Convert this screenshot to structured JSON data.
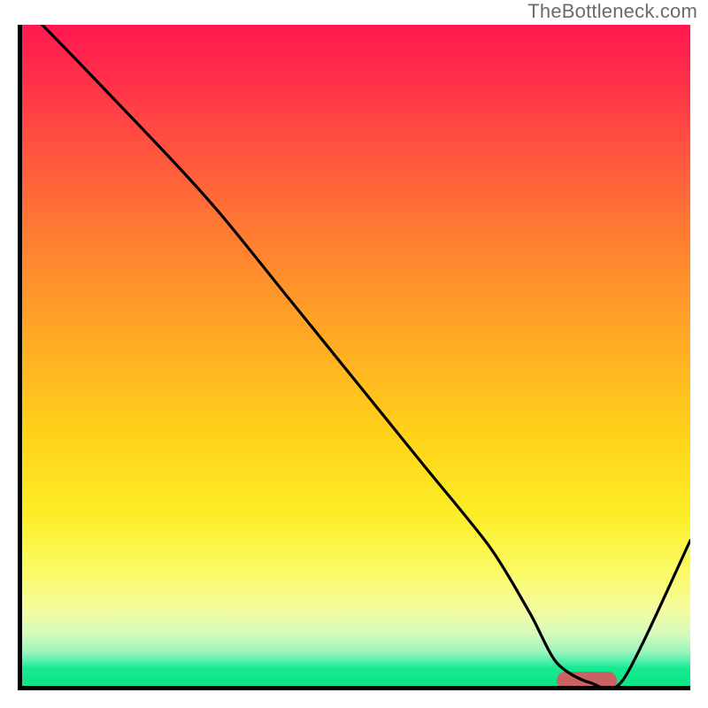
{
  "watermark": "TheBottleneck.com",
  "chart_data": {
    "type": "line",
    "title": "",
    "xlabel": "",
    "ylabel": "",
    "xlim": [
      0,
      100
    ],
    "ylim": [
      0,
      100
    ],
    "x": [
      0,
      3,
      22,
      30,
      40,
      50,
      60,
      70,
      76,
      80,
      85,
      90,
      100
    ],
    "y": [
      102,
      100,
      80,
      71,
      58.5,
      46,
      33.5,
      21,
      11,
      3.5,
      0.5,
      1,
      22
    ],
    "optimum_marker": {
      "x_start": 80,
      "x_end": 89,
      "y": 0.8
    },
    "background_gradient": {
      "stops": [
        {
          "pos": 0,
          "color": "#ff1850"
        },
        {
          "pos": 50,
          "color": "#ffc21e"
        },
        {
          "pos": 85,
          "color": "#fbfb68"
        },
        {
          "pos": 97,
          "color": "#16e991"
        },
        {
          "pos": 100,
          "color": "#0fe687"
        }
      ]
    }
  },
  "plot_geometry": {
    "inner_width": 755,
    "inner_height": 747
  }
}
